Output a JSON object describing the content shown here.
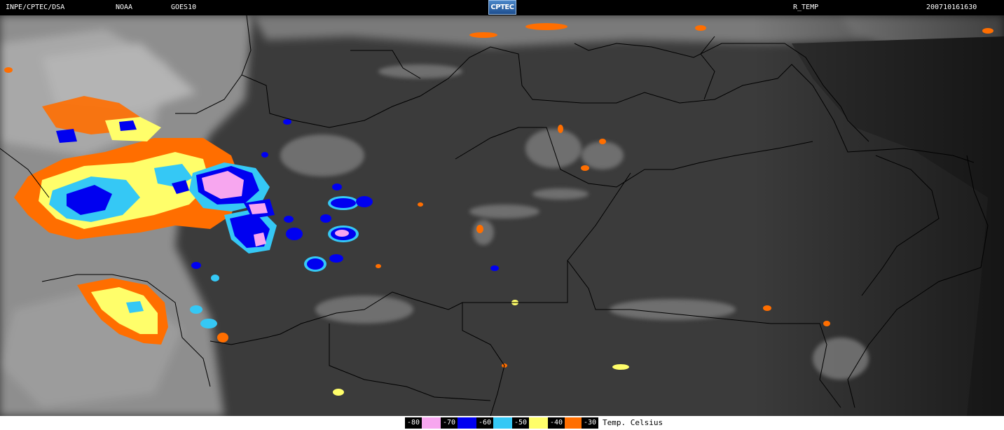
{
  "header": {
    "agency": "INPE/CPTEC/DSA",
    "provider": "NOAA",
    "satellite": "GOES10",
    "logo_text": "CPTEC",
    "product": "R_TEMP",
    "timestamp": "200710161630"
  },
  "legend": {
    "entries": [
      {
        "label": "-80",
        "color": "#f7a6ef"
      },
      {
        "label": "-70",
        "color": "#0000f0"
      },
      {
        "label": "-60",
        "color": "#35c8f5"
      },
      {
        "label": "-50",
        "color": "#fffe6a"
      },
      {
        "label": "-40",
        "color": "#ff6e00"
      },
      {
        "label": "-30",
        "color": null
      }
    ],
    "units": "Temp. Celsius"
  },
  "colors": {
    "background_land": "#3a3a3a",
    "cloud_gray": "#9a9a9a",
    "cloud_light": "#c8c8c8",
    "borders": "#000000",
    "bar": "#000000"
  }
}
